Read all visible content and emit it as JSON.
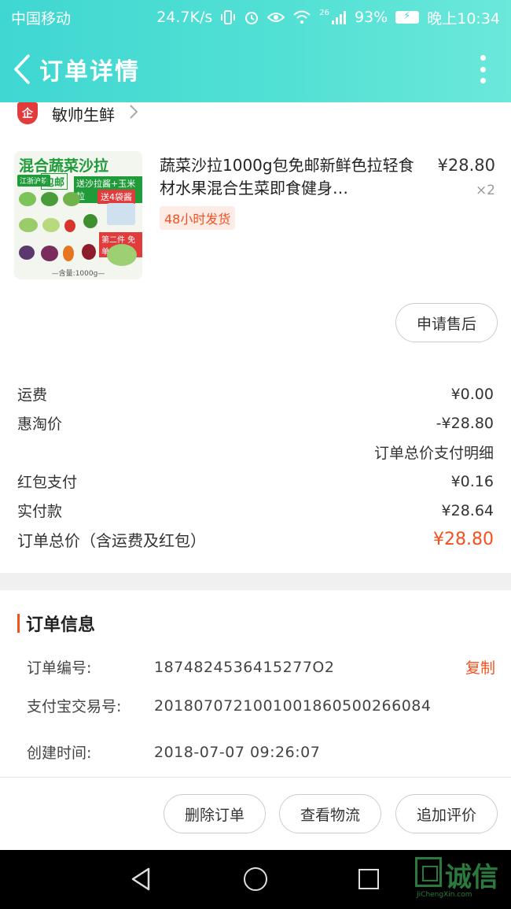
{
  "status_bar": {
    "carrier": "中国移动",
    "speed": "24.7K/s",
    "network": "26",
    "battery_pct": "93%",
    "time": "晚上10:34"
  },
  "header": {
    "title": "订单详情"
  },
  "shop": {
    "badge": "企",
    "name": "敏帅生鲜"
  },
  "product": {
    "image_texts": {
      "title": "混合蔬菜沙拉",
      "tag_region": "江浙沪皖",
      "tag_free_shipping": "包邮",
      "tag_sauce": "送沙拉酱+玉米粒",
      "tag_bags": "送4袋酱",
      "tag_second": "第二件 免单",
      "weight": "—含量:1000g—"
    },
    "title": "蔬菜沙拉1000g包免邮新鲜色拉轻食材水果混合生菜即食健身…",
    "price": "¥28.80",
    "quantity": "×2",
    "shipping_tag": "48小时发货",
    "after_sale_button": "申请售后"
  },
  "fees": [
    {
      "label": "运费",
      "value": "¥0.00"
    },
    {
      "label": "惠淘价",
      "value": "-¥28.80"
    },
    {
      "label": "",
      "value": "订单总价支付明细"
    },
    {
      "label": "红包支付",
      "value": "¥0.16"
    },
    {
      "label": "实付款",
      "value": "¥28.64"
    }
  ],
  "total": {
    "label": "订单总价（含运费及红包）",
    "value": "¥28.80"
  },
  "order_info": {
    "title": "订单信息",
    "rows": [
      {
        "key": "订单编号:",
        "value": "1874824536415277O2"
      },
      {
        "key": "支付宝交易号:",
        "value": "2018070721001001860500266084"
      },
      {
        "key": "创建时间:",
        "value": "2018-07-07 09:26:07"
      }
    ],
    "copy_label": "复制"
  },
  "actions": {
    "delete": "删除订单",
    "logistics": "查看物流",
    "review": "追加评价"
  },
  "watermark": {
    "cn": "诚信",
    "en": "JiChengXin.com"
  },
  "colors": {
    "header_gradient_start": "#3fd7d2",
    "header_gradient_end": "#6ae8da",
    "accent_orange": "#f4511e"
  }
}
